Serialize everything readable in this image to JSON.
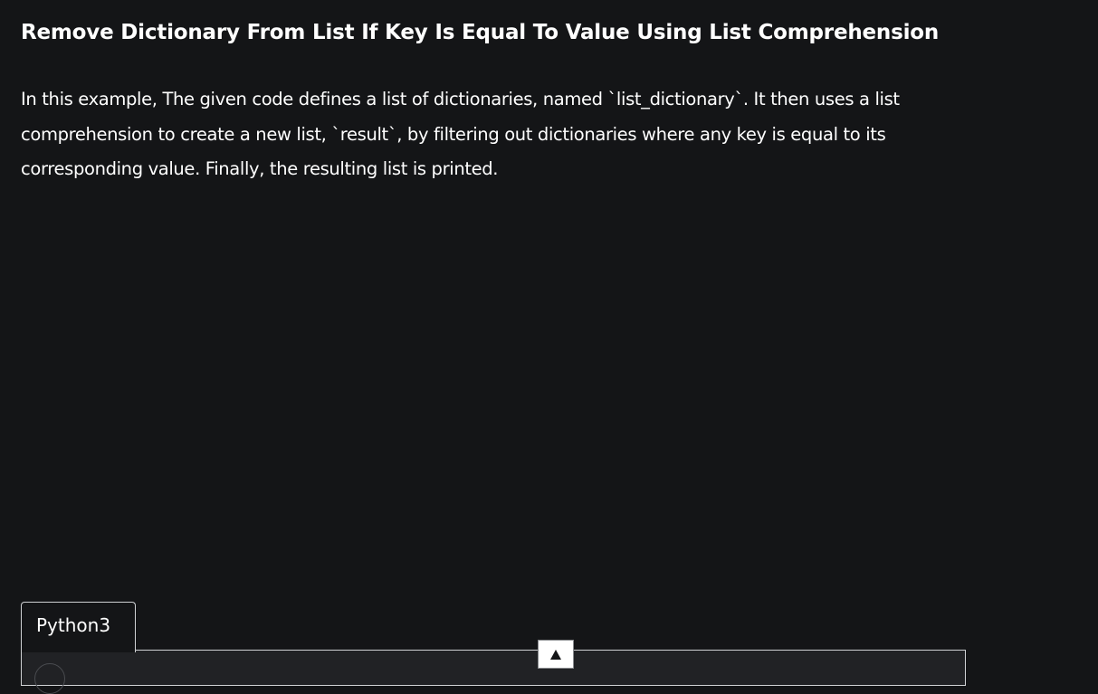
{
  "article": {
    "heading": "Remove Dictionary From List If Key Is Equal To Value Using List Comprehension",
    "paragraph": "In this example, The given code defines a list of dictionaries, named `list_dictionary`. It then uses a list comprehension to create a new list, `result`, by filtering out dictionaries where any key is equal to its corresponding value. Finally, the resulting list is printed."
  },
  "code_block": {
    "language_tab": "Python3"
  },
  "icons": {
    "scroll_top": "arrow-up-icon"
  },
  "colors": {
    "background": "#141517",
    "text": "#ffffff",
    "border": "#cfd1d4"
  }
}
